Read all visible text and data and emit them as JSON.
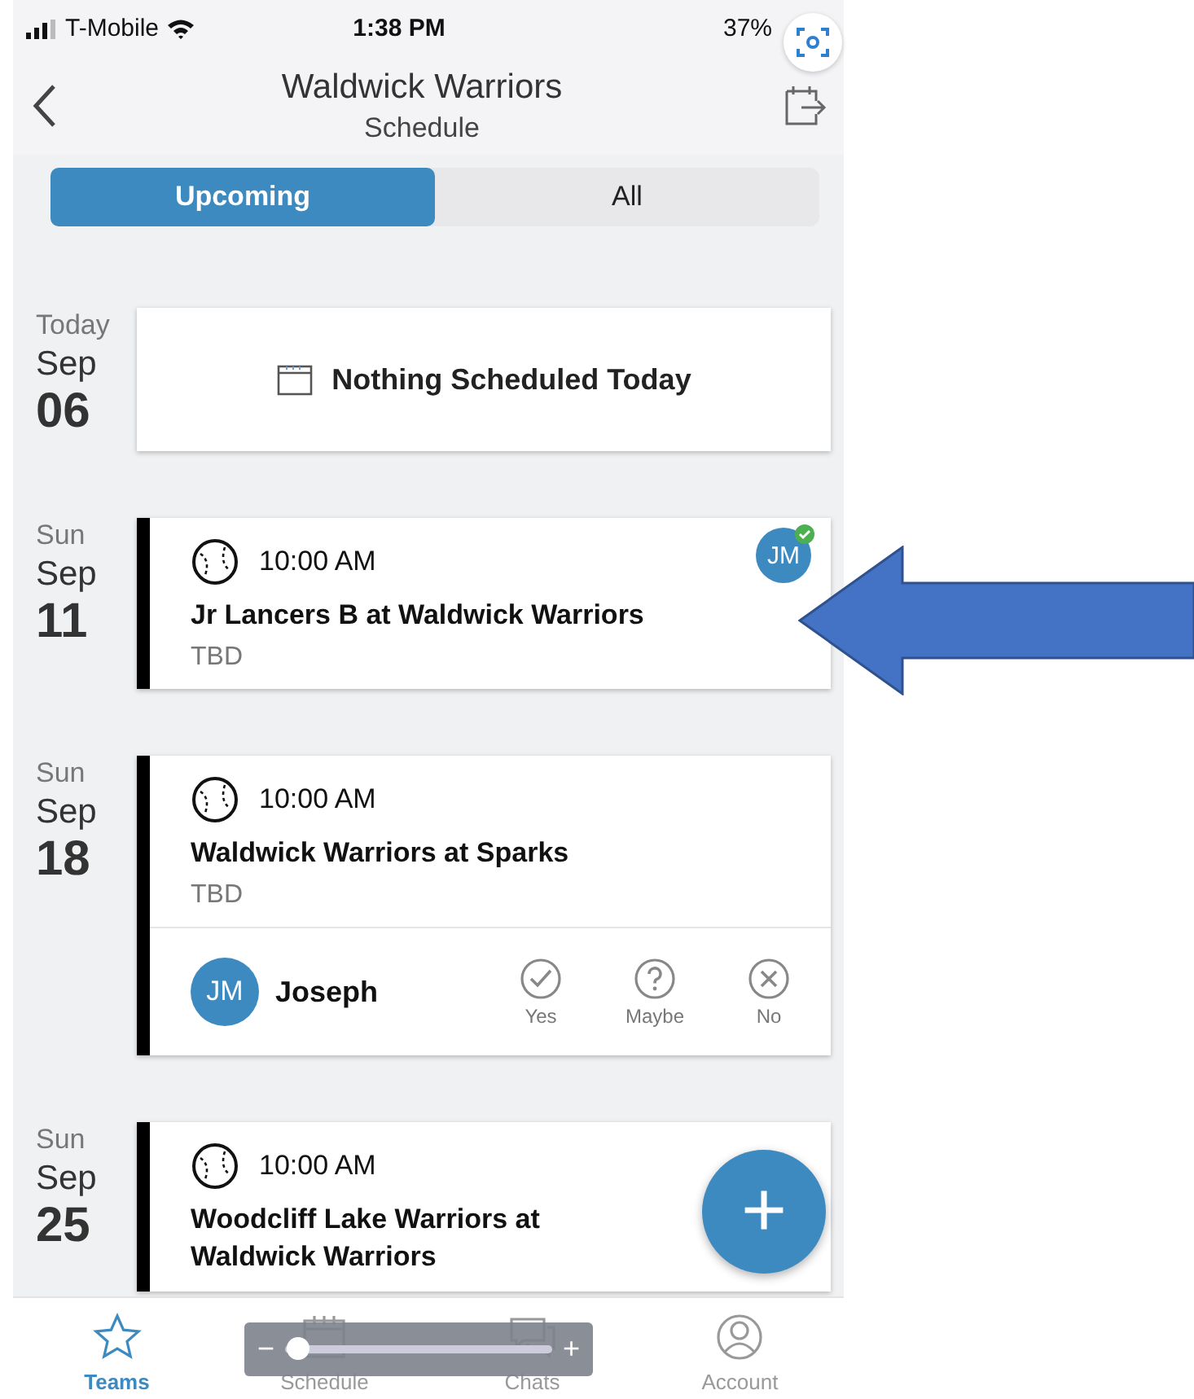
{
  "status_bar": {
    "carrier": "T-Mobile",
    "time": "1:38 PM",
    "battery": "37%"
  },
  "header": {
    "title": "Waldwick Warriors",
    "subtitle": "Schedule"
  },
  "tabs": [
    {
      "label": "Upcoming",
      "selected": true
    },
    {
      "label": "All",
      "selected": false
    }
  ],
  "days": [
    {
      "kind": "empty",
      "weekday": "Today",
      "month": "Sep",
      "day": "06",
      "message": "Nothing Scheduled Today"
    },
    {
      "kind": "event",
      "weekday": "Sun",
      "month": "Sep",
      "day": "11",
      "time": "10:00 AM",
      "title": "Jr Lancers B at Waldwick Warriors",
      "location": "TBD",
      "avatar": {
        "initials": "JM",
        "confirmed": true
      }
    },
    {
      "kind": "event",
      "weekday": "Sun",
      "month": "Sep",
      "day": "18",
      "time": "10:00 AM",
      "title": "Waldwick Warriors at Sparks",
      "location": "TBD",
      "rsvp": {
        "initials": "JM",
        "name": "Joseph",
        "options": [
          {
            "kind": "yes",
            "label": "Yes",
            "selected": false
          },
          {
            "kind": "maybe",
            "label": "Maybe",
            "selected": false
          },
          {
            "kind": "no",
            "label": "No",
            "selected": false
          }
        ]
      }
    },
    {
      "kind": "event",
      "weekday": "Sun",
      "month": "Sep",
      "day": "25",
      "time": "10:00 AM",
      "title": "Woodcliff Lake Warriors at Waldwick Warriors"
    }
  ],
  "add_button": {
    "label": "+"
  },
  "tab_bar": [
    {
      "kind": "teams",
      "label": "Teams",
      "selected": true
    },
    {
      "kind": "schedule",
      "label": "Schedule",
      "selected": false
    },
    {
      "kind": "chats",
      "label": "Chats",
      "selected": false
    },
    {
      "kind": "account",
      "label": "Account",
      "selected": false
    }
  ],
  "zoom_slider": {
    "minus": "−",
    "plus": "+",
    "level": 0.05
  }
}
